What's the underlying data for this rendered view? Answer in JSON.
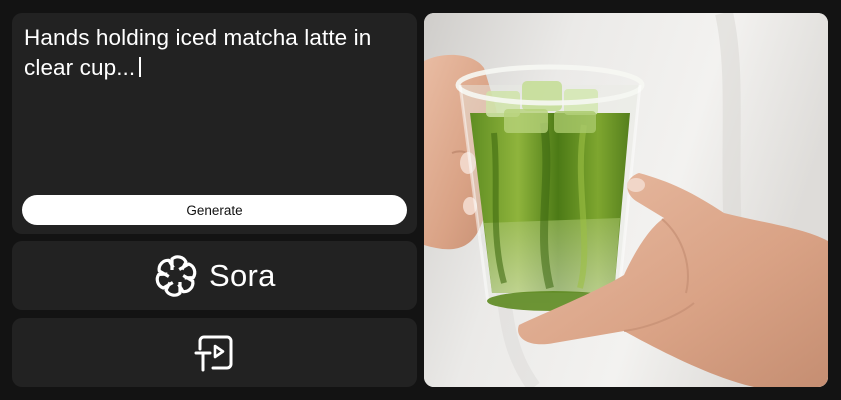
{
  "prompt": {
    "text": "Hands holding iced matcha latte in clear cup..."
  },
  "generate": {
    "label": "Generate"
  },
  "brand": {
    "name": "Sora",
    "logo_icon": "openai-logo-icon"
  },
  "storyboard": {
    "icon": "storyboard-icon"
  },
  "colors": {
    "background": "#131313",
    "panel": "#222222",
    "button": "#ffffff",
    "matcha": "#6b9a2a"
  }
}
